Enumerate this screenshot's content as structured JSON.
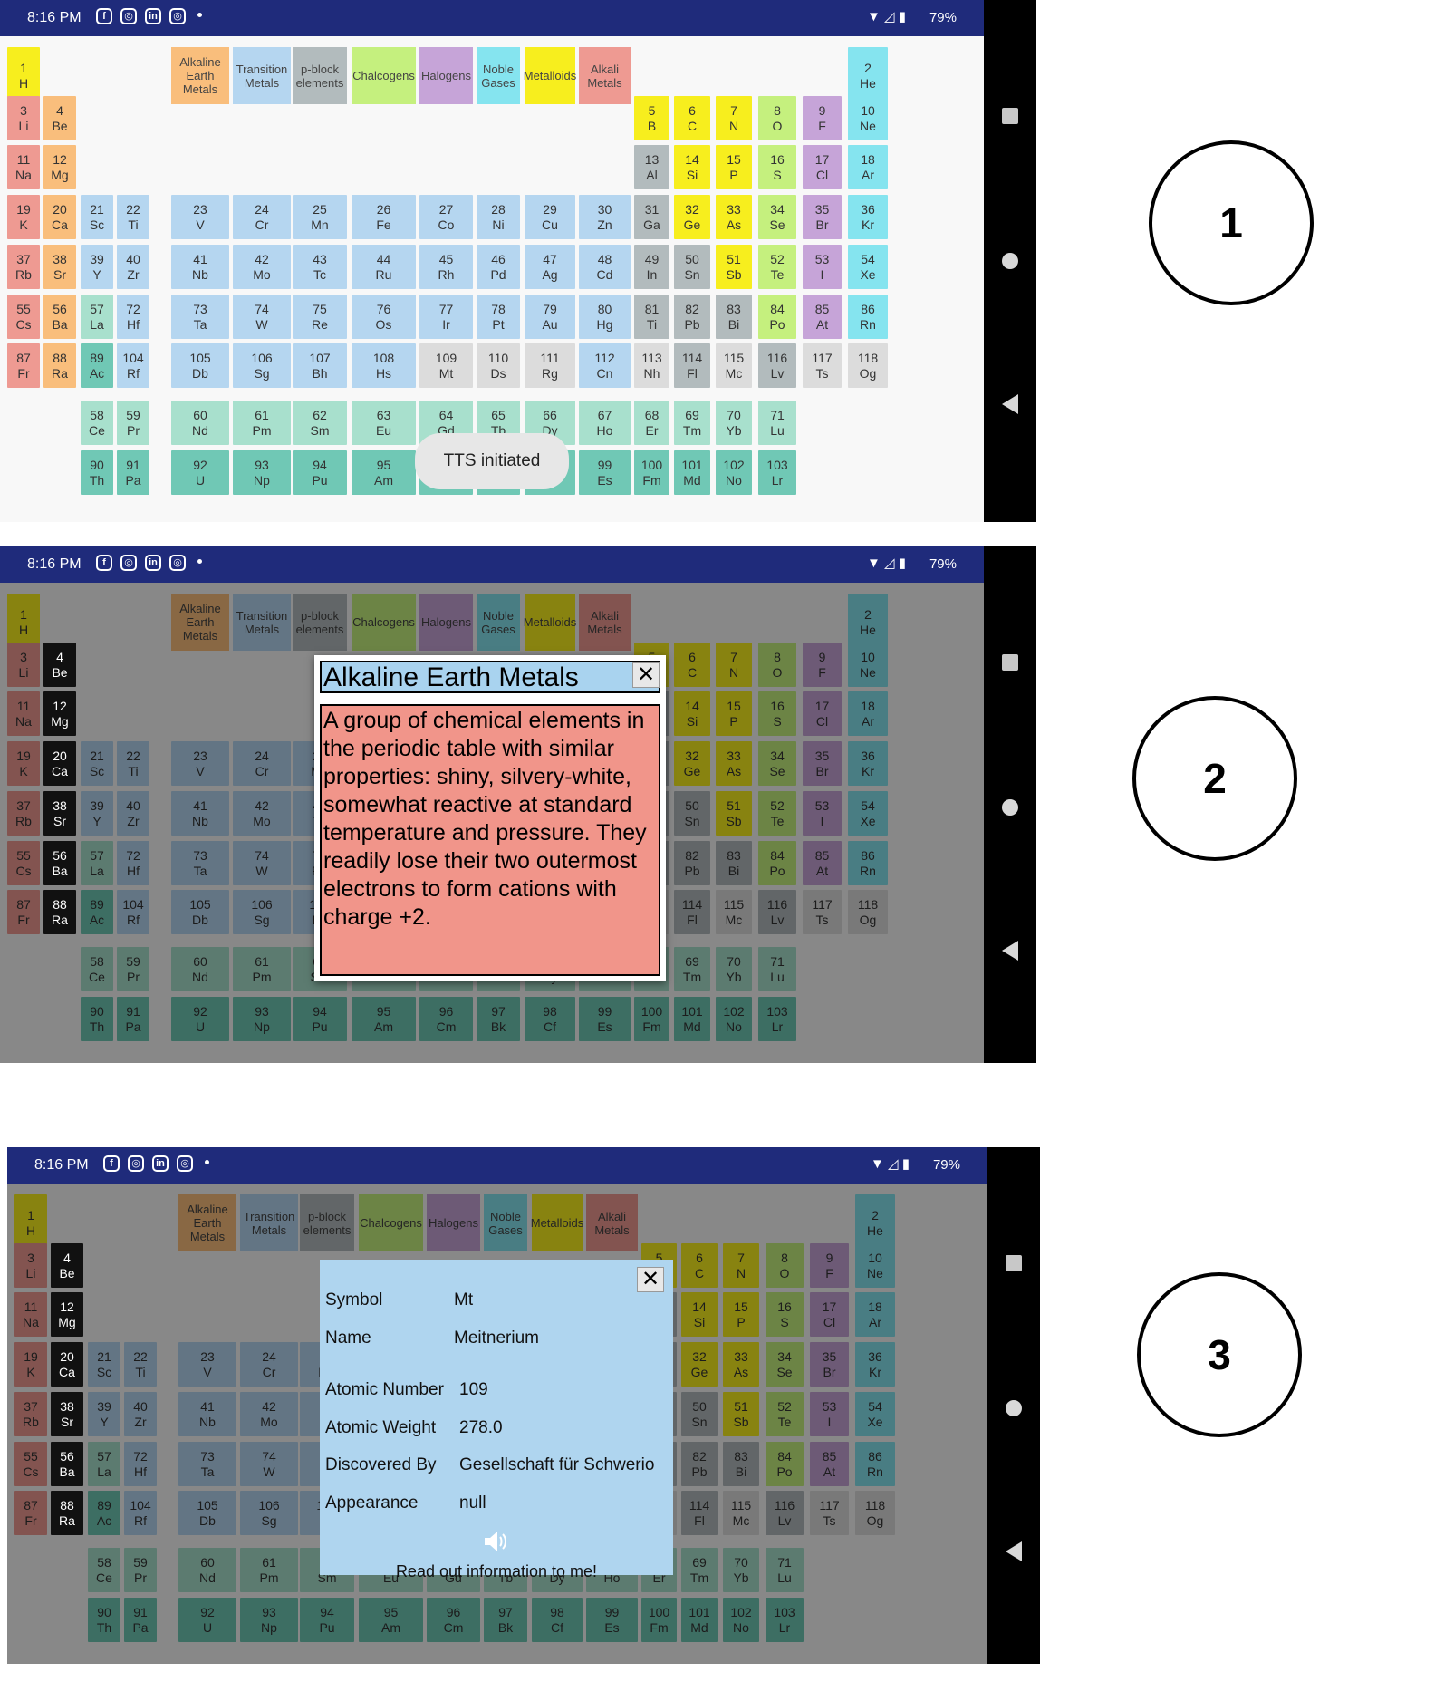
{
  "status": {
    "time": "8:16 PM",
    "battery": "79%",
    "icons": [
      "facebook-icon",
      "instagram-icon",
      "linkedin-icon",
      "instagram-icon"
    ]
  },
  "colors": {
    "alkaline": "#f9be7c",
    "transition": "#b5d6f0",
    "pblock": "#b2bbbd",
    "chalcogen": "#c5f07e",
    "halogen": "#c6a4d8",
    "noble": "#85e4ef",
    "metalloid": "#f7ee1e",
    "alkali": "#ee9a92",
    "lanthanide": "#a8e0cd",
    "actinide": "#70c8b5",
    "unknown": "#dcdcdc",
    "hydrogen": "#f7ee1e",
    "selected": "#111111"
  },
  "categories": [
    {
      "label": "Alkaline Earth Metals",
      "color": "alkaline"
    },
    {
      "label": "Transition Metals",
      "color": "transition"
    },
    {
      "label": "p-block elements",
      "color": "pblock"
    },
    {
      "label": "Chalcogens",
      "color": "chalcogen"
    },
    {
      "label": "Halogens",
      "color": "halogen"
    },
    {
      "label": "Noble Gases",
      "color": "noble"
    },
    {
      "label": "Metalloids",
      "color": "metalloid"
    },
    {
      "label": "Alkali Metals",
      "color": "alkali"
    }
  ],
  "elements": [
    {
      "n": "1",
      "s": "H",
      "c": "hydrogen",
      "r": 0,
      "col": 0
    },
    {
      "n": "2",
      "s": "He",
      "c": "noble",
      "r": 0,
      "col": 17
    },
    {
      "n": "3",
      "s": "Li",
      "c": "alkali",
      "r": 1,
      "col": 0
    },
    {
      "n": "4",
      "s": "Be",
      "c": "alkaline",
      "r": 1,
      "col": 1
    },
    {
      "n": "5",
      "s": "B",
      "c": "metalloid",
      "r": 1,
      "col": 12
    },
    {
      "n": "6",
      "s": "C",
      "c": "metalloid",
      "r": 1,
      "col": 13
    },
    {
      "n": "7",
      "s": "N",
      "c": "metalloid",
      "r": 1,
      "col": 14
    },
    {
      "n": "8",
      "s": "O",
      "c": "chalcogen",
      "r": 1,
      "col": 15
    },
    {
      "n": "9",
      "s": "F",
      "c": "halogen",
      "r": 1,
      "col": 16
    },
    {
      "n": "10",
      "s": "Ne",
      "c": "noble",
      "r": 1,
      "col": 17
    },
    {
      "n": "11",
      "s": "Na",
      "c": "alkali",
      "r": 2,
      "col": 0
    },
    {
      "n": "12",
      "s": "Mg",
      "c": "alkaline",
      "r": 2,
      "col": 1
    },
    {
      "n": "13",
      "s": "Al",
      "c": "pblock",
      "r": 2,
      "col": 12
    },
    {
      "n": "14",
      "s": "Si",
      "c": "metalloid",
      "r": 2,
      "col": 13
    },
    {
      "n": "15",
      "s": "P",
      "c": "metalloid",
      "r": 2,
      "col": 14
    },
    {
      "n": "16",
      "s": "S",
      "c": "chalcogen",
      "r": 2,
      "col": 15
    },
    {
      "n": "17",
      "s": "Cl",
      "c": "halogen",
      "r": 2,
      "col": 16
    },
    {
      "n": "18",
      "s": "Ar",
      "c": "noble",
      "r": 2,
      "col": 17
    },
    {
      "n": "19",
      "s": "K",
      "c": "alkali",
      "r": 3,
      "col": 0
    },
    {
      "n": "20",
      "s": "Ca",
      "c": "alkaline",
      "r": 3,
      "col": 1
    },
    {
      "n": "21",
      "s": "Sc",
      "c": "transition",
      "r": 3,
      "col": 2
    },
    {
      "n": "22",
      "s": "Ti",
      "c": "transition",
      "r": 3,
      "col": 3
    },
    {
      "n": "23",
      "s": "V",
      "c": "transition",
      "r": 3,
      "col": 4
    },
    {
      "n": "24",
      "s": "Cr",
      "c": "transition",
      "r": 3,
      "col": 5
    },
    {
      "n": "25",
      "s": "Mn",
      "c": "transition",
      "r": 3,
      "col": 6
    },
    {
      "n": "26",
      "s": "Fe",
      "c": "transition",
      "r": 3,
      "col": 7
    },
    {
      "n": "27",
      "s": "Co",
      "c": "transition",
      "r": 3,
      "col": 8
    },
    {
      "n": "28",
      "s": "Ni",
      "c": "transition",
      "r": 3,
      "col": 9
    },
    {
      "n": "29",
      "s": "Cu",
      "c": "transition",
      "r": 3,
      "col": 10
    },
    {
      "n": "30",
      "s": "Zn",
      "c": "transition",
      "r": 3,
      "col": 11
    },
    {
      "n": "31",
      "s": "Ga",
      "c": "pblock",
      "r": 3,
      "col": 12
    },
    {
      "n": "32",
      "s": "Ge",
      "c": "metalloid",
      "r": 3,
      "col": 13
    },
    {
      "n": "33",
      "s": "As",
      "c": "metalloid",
      "r": 3,
      "col": 14
    },
    {
      "n": "34",
      "s": "Se",
      "c": "chalcogen",
      "r": 3,
      "col": 15
    },
    {
      "n": "35",
      "s": "Br",
      "c": "halogen",
      "r": 3,
      "col": 16
    },
    {
      "n": "36",
      "s": "Kr",
      "c": "noble",
      "r": 3,
      "col": 17
    },
    {
      "n": "37",
      "s": "Rb",
      "c": "alkali",
      "r": 4,
      "col": 0
    },
    {
      "n": "38",
      "s": "Sr",
      "c": "alkaline",
      "r": 4,
      "col": 1
    },
    {
      "n": "39",
      "s": "Y",
      "c": "transition",
      "r": 4,
      "col": 2
    },
    {
      "n": "40",
      "s": "Zr",
      "c": "transition",
      "r": 4,
      "col": 3
    },
    {
      "n": "41",
      "s": "Nb",
      "c": "transition",
      "r": 4,
      "col": 4
    },
    {
      "n": "42",
      "s": "Mo",
      "c": "transition",
      "r": 4,
      "col": 5
    },
    {
      "n": "43",
      "s": "Tc",
      "c": "transition",
      "r": 4,
      "col": 6
    },
    {
      "n": "44",
      "s": "Ru",
      "c": "transition",
      "r": 4,
      "col": 7
    },
    {
      "n": "45",
      "s": "Rh",
      "c": "transition",
      "r": 4,
      "col": 8
    },
    {
      "n": "46",
      "s": "Pd",
      "c": "transition",
      "r": 4,
      "col": 9
    },
    {
      "n": "47",
      "s": "Ag",
      "c": "transition",
      "r": 4,
      "col": 10
    },
    {
      "n": "48",
      "s": "Cd",
      "c": "transition",
      "r": 4,
      "col": 11
    },
    {
      "n": "49",
      "s": "In",
      "c": "pblock",
      "r": 4,
      "col": 12
    },
    {
      "n": "50",
      "s": "Sn",
      "c": "pblock",
      "r": 4,
      "col": 13
    },
    {
      "n": "51",
      "s": "Sb",
      "c": "metalloid",
      "r": 4,
      "col": 14
    },
    {
      "n": "52",
      "s": "Te",
      "c": "chalcogen",
      "r": 4,
      "col": 15
    },
    {
      "n": "53",
      "s": "I",
      "c": "halogen",
      "r": 4,
      "col": 16
    },
    {
      "n": "54",
      "s": "Xe",
      "c": "noble",
      "r": 4,
      "col": 17
    },
    {
      "n": "55",
      "s": "Cs",
      "c": "alkali",
      "r": 5,
      "col": 0
    },
    {
      "n": "56",
      "s": "Ba",
      "c": "alkaline",
      "r": 5,
      "col": 1
    },
    {
      "n": "57",
      "s": "La",
      "c": "lanthanide",
      "r": 5,
      "col": 2
    },
    {
      "n": "72",
      "s": "Hf",
      "c": "transition",
      "r": 5,
      "col": 3
    },
    {
      "n": "73",
      "s": "Ta",
      "c": "transition",
      "r": 5,
      "col": 4
    },
    {
      "n": "74",
      "s": "W",
      "c": "transition",
      "r": 5,
      "col": 5
    },
    {
      "n": "75",
      "s": "Re",
      "c": "transition",
      "r": 5,
      "col": 6
    },
    {
      "n": "76",
      "s": "Os",
      "c": "transition",
      "r": 5,
      "col": 7
    },
    {
      "n": "77",
      "s": "Ir",
      "c": "transition",
      "r": 5,
      "col": 8
    },
    {
      "n": "78",
      "s": "Pt",
      "c": "transition",
      "r": 5,
      "col": 9
    },
    {
      "n": "79",
      "s": "Au",
      "c": "transition",
      "r": 5,
      "col": 10
    },
    {
      "n": "80",
      "s": "Hg",
      "c": "transition",
      "r": 5,
      "col": 11
    },
    {
      "n": "81",
      "s": "Ti",
      "c": "pblock",
      "r": 5,
      "col": 12
    },
    {
      "n": "82",
      "s": "Pb",
      "c": "pblock",
      "r": 5,
      "col": 13
    },
    {
      "n": "83",
      "s": "Bi",
      "c": "pblock",
      "r": 5,
      "col": 14
    },
    {
      "n": "84",
      "s": "Po",
      "c": "chalcogen",
      "r": 5,
      "col": 15
    },
    {
      "n": "85",
      "s": "At",
      "c": "halogen",
      "r": 5,
      "col": 16
    },
    {
      "n": "86",
      "s": "Rn",
      "c": "noble",
      "r": 5,
      "col": 17
    },
    {
      "n": "87",
      "s": "Fr",
      "c": "alkali",
      "r": 6,
      "col": 0
    },
    {
      "n": "88",
      "s": "Ra",
      "c": "alkaline",
      "r": 6,
      "col": 1
    },
    {
      "n": "89",
      "s": "Ac",
      "c": "actinide",
      "r": 6,
      "col": 2
    },
    {
      "n": "104",
      "s": "Rf",
      "c": "transition",
      "r": 6,
      "col": 3
    },
    {
      "n": "105",
      "s": "Db",
      "c": "transition",
      "r": 6,
      "col": 4
    },
    {
      "n": "106",
      "s": "Sg",
      "c": "transition",
      "r": 6,
      "col": 5
    },
    {
      "n": "107",
      "s": "Bh",
      "c": "transition",
      "r": 6,
      "col": 6
    },
    {
      "n": "108",
      "s": "Hs",
      "c": "transition",
      "r": 6,
      "col": 7
    },
    {
      "n": "109",
      "s": "Mt",
      "c": "unknown",
      "r": 6,
      "col": 8
    },
    {
      "n": "110",
      "s": "Ds",
      "c": "unknown",
      "r": 6,
      "col": 9
    },
    {
      "n": "111",
      "s": "Rg",
      "c": "unknown",
      "r": 6,
      "col": 10
    },
    {
      "n": "112",
      "s": "Cn",
      "c": "transition",
      "r": 6,
      "col": 11
    },
    {
      "n": "113",
      "s": "Nh",
      "c": "unknown",
      "r": 6,
      "col": 12
    },
    {
      "n": "114",
      "s": "Fl",
      "c": "pblock",
      "r": 6,
      "col": 13
    },
    {
      "n": "115",
      "s": "Mc",
      "c": "unknown",
      "r": 6,
      "col": 14
    },
    {
      "n": "116",
      "s": "Lv",
      "c": "pblock",
      "r": 6,
      "col": 15
    },
    {
      "n": "117",
      "s": "Ts",
      "c": "unknown",
      "r": 6,
      "col": 16
    },
    {
      "n": "118",
      "s": "Og",
      "c": "unknown",
      "r": 6,
      "col": 17
    },
    {
      "n": "58",
      "s": "Ce",
      "c": "lanthanide",
      "r": 7,
      "col": 2
    },
    {
      "n": "59",
      "s": "Pr",
      "c": "lanthanide",
      "r": 7,
      "col": 3
    },
    {
      "n": "60",
      "s": "Nd",
      "c": "lanthanide",
      "r": 7,
      "col": 4
    },
    {
      "n": "61",
      "s": "Pm",
      "c": "lanthanide",
      "r": 7,
      "col": 5
    },
    {
      "n": "62",
      "s": "Sm",
      "c": "lanthanide",
      "r": 7,
      "col": 6
    },
    {
      "n": "63",
      "s": "Eu",
      "c": "lanthanide",
      "r": 7,
      "col": 7
    },
    {
      "n": "64",
      "s": "Gd",
      "c": "lanthanide",
      "r": 7,
      "col": 8
    },
    {
      "n": "65",
      "s": "Tb",
      "c": "lanthanide",
      "r": 7,
      "col": 9
    },
    {
      "n": "66",
      "s": "Dy",
      "c": "lanthanide",
      "r": 7,
      "col": 10
    },
    {
      "n": "67",
      "s": "Ho",
      "c": "lanthanide",
      "r": 7,
      "col": 11
    },
    {
      "n": "68",
      "s": "Er",
      "c": "lanthanide",
      "r": 7,
      "col": 12
    },
    {
      "n": "69",
      "s": "Tm",
      "c": "lanthanide",
      "r": 7,
      "col": 13
    },
    {
      "n": "70",
      "s": "Yb",
      "c": "lanthanide",
      "r": 7,
      "col": 14
    },
    {
      "n": "71",
      "s": "Lu",
      "c": "lanthanide",
      "r": 7,
      "col": 15
    },
    {
      "n": "90",
      "s": "Th",
      "c": "actinide",
      "r": 8,
      "col": 2
    },
    {
      "n": "91",
      "s": "Pa",
      "c": "actinide",
      "r": 8,
      "col": 3
    },
    {
      "n": "92",
      "s": "U",
      "c": "actinide",
      "r": 8,
      "col": 4
    },
    {
      "n": "93",
      "s": "Np",
      "c": "actinide",
      "r": 8,
      "col": 5
    },
    {
      "n": "94",
      "s": "Pu",
      "c": "actinide",
      "r": 8,
      "col": 6
    },
    {
      "n": "95",
      "s": "Am",
      "c": "actinide",
      "r": 8,
      "col": 7
    },
    {
      "n": "96",
      "s": "Cm",
      "c": "actinide",
      "r": 8,
      "col": 8
    },
    {
      "n": "97",
      "s": "Bk",
      "c": "actinide",
      "r": 8,
      "col": 9
    },
    {
      "n": "98",
      "s": "Cf",
      "c": "actinide",
      "r": 8,
      "col": 10
    },
    {
      "n": "99",
      "s": "Es",
      "c": "actinide",
      "r": 8,
      "col": 11
    },
    {
      "n": "100",
      "s": "Fm",
      "c": "actinide",
      "r": 8,
      "col": 12
    },
    {
      "n": "101",
      "s": "Md",
      "c": "actinide",
      "r": 8,
      "col": 13
    },
    {
      "n": "102",
      "s": "No",
      "c": "actinide",
      "r": 8,
      "col": 14
    },
    {
      "n": "103",
      "s": "Lr",
      "c": "actinide",
      "r": 8,
      "col": 15
    }
  ],
  "screens": [
    {
      "label": "1",
      "toast": "TTS initiated",
      "highlight": []
    },
    {
      "label": "2",
      "highlight": [
        "4",
        "12",
        "20",
        "38",
        "56",
        "88"
      ],
      "dialog": {
        "title": "Alkaline Earth Metals",
        "close": "✕",
        "body": "A group of chemical elements in the periodic table with similar properties: shiny, silvery-white, somewhat reactive at standard temperature and pressure. They readily lose their two outermost electrons to form cations with charge +2."
      }
    },
    {
      "label": "3",
      "highlight": [
        "4",
        "12",
        "20",
        "38",
        "56",
        "88"
      ],
      "info": {
        "close": "✕",
        "rows": [
          {
            "label": "Symbol",
            "value": "Mt"
          },
          {
            "label": "Name",
            "value": "Meitnerium"
          },
          {
            "label": "Atomic Number",
            "value": "109"
          },
          {
            "label": "Atomic Weight",
            "value": "278.0"
          },
          {
            "label": "Discovered By",
            "value": "Gesellschaft für Schwerio"
          },
          {
            "label": "Appearance",
            "value": "null"
          }
        ],
        "speaker_icon": "speaker-icon",
        "read_label": "Read out information to me!"
      }
    }
  ]
}
